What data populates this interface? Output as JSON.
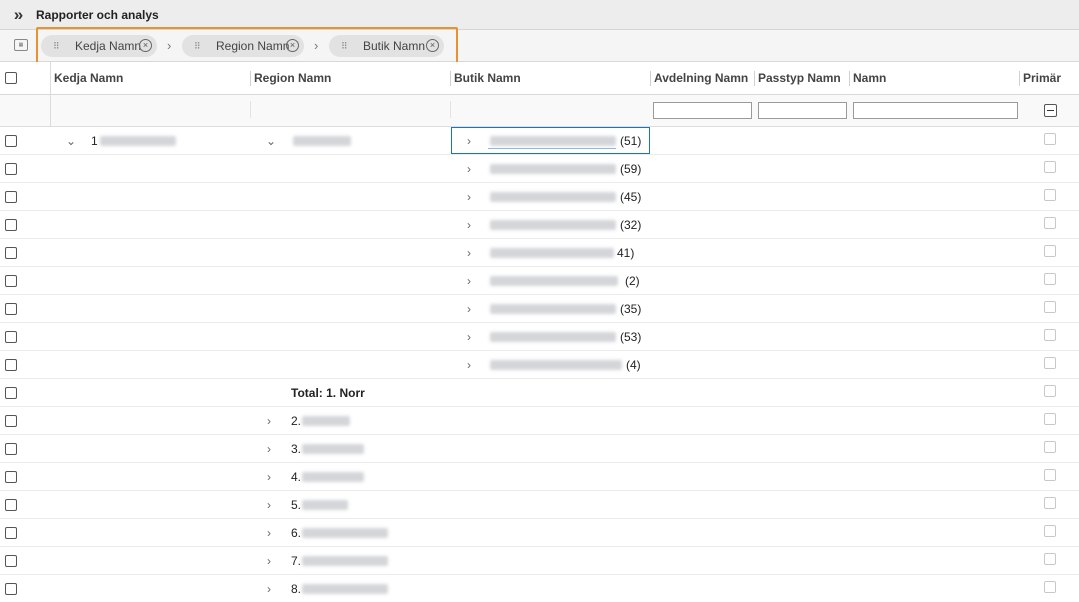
{
  "topbar": {
    "expand_glyph": "»",
    "title": "Rapporter och analys"
  },
  "groupbar": {
    "panel_icon": "table-icon",
    "chips": [
      {
        "label": "Kedja Namn"
      },
      {
        "label": "Region Namn"
      },
      {
        "label": "Butik Namn"
      }
    ],
    "separator_glyph": "›",
    "remove_glyph": "×",
    "grip_glyph": "⠿",
    "highlight_color": "#e8912e"
  },
  "columns": [
    "Kedja Namn",
    "Region Namn",
    "Butik Namn",
    "Avdelning Namn",
    "Passtyp Namn",
    "Namn",
    "Primär"
  ],
  "filter": {
    "avdelning_value": "",
    "passtyp_value": "",
    "namn_value": ""
  },
  "tree": {
    "chain": {
      "label": "1"
    },
    "region": {
      "label": ""
    },
    "stores": [
      {
        "count": "(51)"
      },
      {
        "count": "(59)"
      },
      {
        "count": "(45)"
      },
      {
        "count": "(32)"
      },
      {
        "count": "41)"
      },
      {
        "count": "(2)"
      },
      {
        "count": "(35)"
      },
      {
        "count": "(53)"
      },
      {
        "count": "(4)"
      }
    ],
    "total_label": "Total: 1. Norr",
    "other_regions": [
      {
        "prefix": "2."
      },
      {
        "prefix": "3."
      },
      {
        "prefix": "4."
      },
      {
        "prefix": "5."
      },
      {
        "prefix": "6."
      },
      {
        "prefix": "7."
      },
      {
        "prefix": "8."
      }
    ]
  }
}
